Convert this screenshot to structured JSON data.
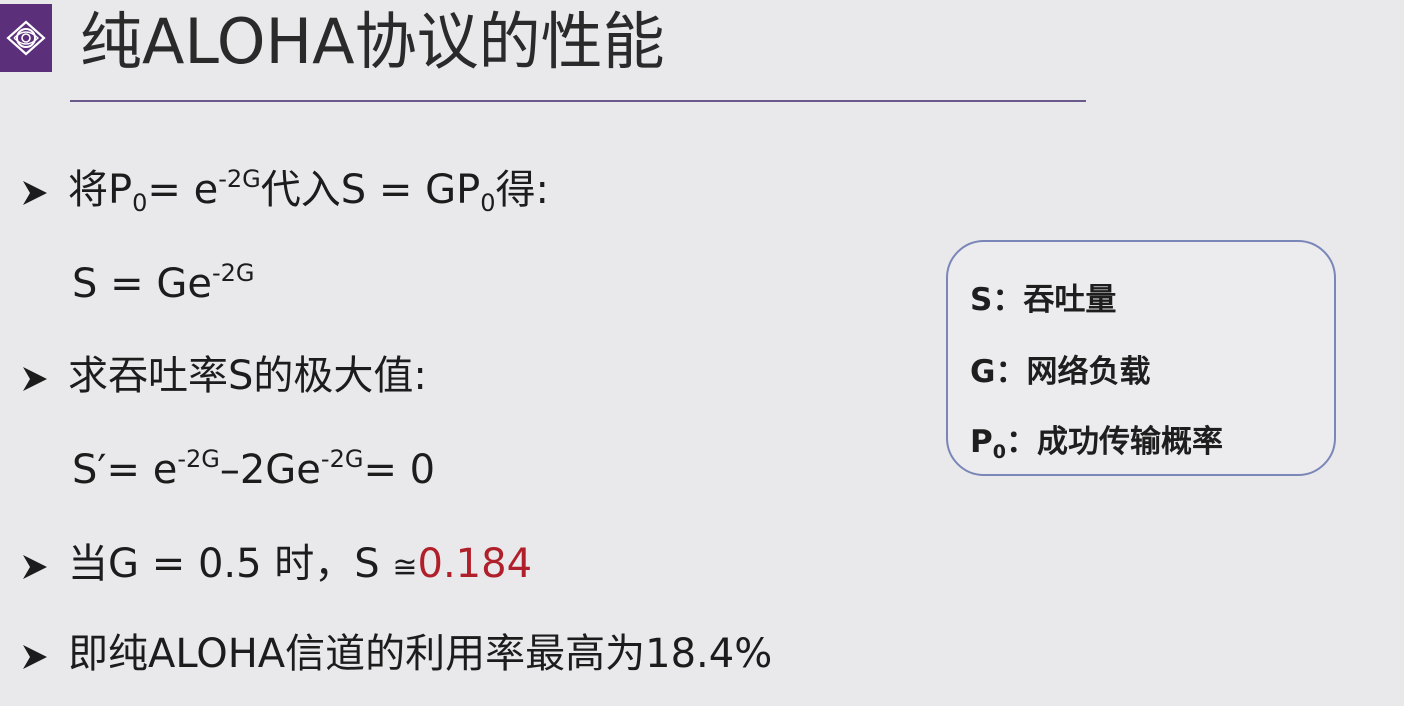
{
  "title": "纯ALOHA协议的性能",
  "bullets": [
    {
      "pre": "将P",
      "sub1": "0",
      "mid1": "= e",
      "sup1": "-2G",
      "mid2": "代入S = GP",
      "sub2": "0",
      "post": "得:"
    },
    {
      "pre": "S = Ge",
      "sup1": "-2G"
    },
    {
      "text": "求吞吐率S的极大值:"
    },
    {
      "pre": "S′= e",
      "sup1": "-2G",
      "mid1": "–2Ge",
      "sup2": "-2G",
      "post": "= 0"
    },
    {
      "pre": "当G = 0.5 时，S ",
      "approx": "≅",
      "highlight": "0.184"
    },
    {
      "text": "即纯ALOHA信道的利用率最高为18.4%"
    }
  ],
  "legend": {
    "s": "S：吞吐量",
    "g": "G：网络负载",
    "p_pre": "P",
    "p_sub": "0",
    "p_post": "：成功传输概率"
  },
  "colors": {
    "accent": "#5b2f7a",
    "highlight": "#b0202a",
    "legend_border": "#7b86b8"
  },
  "icons": {
    "bullet": "arrowhead-bullet-icon",
    "logo": "logo-icon"
  }
}
